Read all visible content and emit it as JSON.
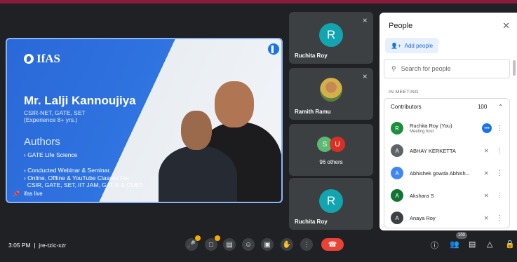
{
  "presentation": {
    "logo_text": "IfAS",
    "speaker_name": "Mr. Lalji Kannoujiya",
    "qualifications": [
      "CSIR-NET, GATE, SET",
      "(Experience 8+ yrs.)"
    ],
    "section_heading": "Authors",
    "bullets": [
      "› GATE Life Science",
      "› Conducted Webinar & Seminar.",
      "› Online, Offline & YouTube Classes For",
      "  CSIR, GATE, SET, IIT JAM, GAT-B & CUET."
    ],
    "tile_label": "ifas live"
  },
  "tiles": [
    {
      "name": "Ruchita Roy",
      "initial": "R",
      "muted": true
    },
    {
      "name": "Ramith Ramu",
      "muted": true
    },
    {
      "others_initials": [
        "S",
        "U"
      ],
      "others_label": "96 others"
    },
    {
      "name": "Ruchita Roy",
      "initial": "R"
    }
  ],
  "people_panel": {
    "title": "People",
    "add_people": "Add people",
    "search_placeholder": "Search for people",
    "in_meeting": "IN MEETING",
    "contributors_label": "Contributors",
    "contributors_count": "100",
    "participants": [
      {
        "name": "Ruchita Roy (You)",
        "sub": "Meeting host",
        "initial": "R",
        "color": "#1e8e3e"
      },
      {
        "name": "ABHAY KERKETTA",
        "initial": "A",
        "color": "#5f6368"
      },
      {
        "name": "Abhishek gowda Abhish...",
        "initial": "A",
        "color": "#4285f4"
      },
      {
        "name": "Akshara S",
        "initial": "A",
        "color": "#137333"
      },
      {
        "name": "Anaya Roy",
        "initial": "A",
        "color": "#3c4043"
      }
    ]
  },
  "bottom_bar": {
    "time_code": "3:05 PM  |  jre-tzic-xzr",
    "people_badge": "100"
  },
  "colors": {
    "accent": "#1a73e8",
    "end_call": "#ea4335",
    "top_stripe": "#8a1b3c"
  }
}
